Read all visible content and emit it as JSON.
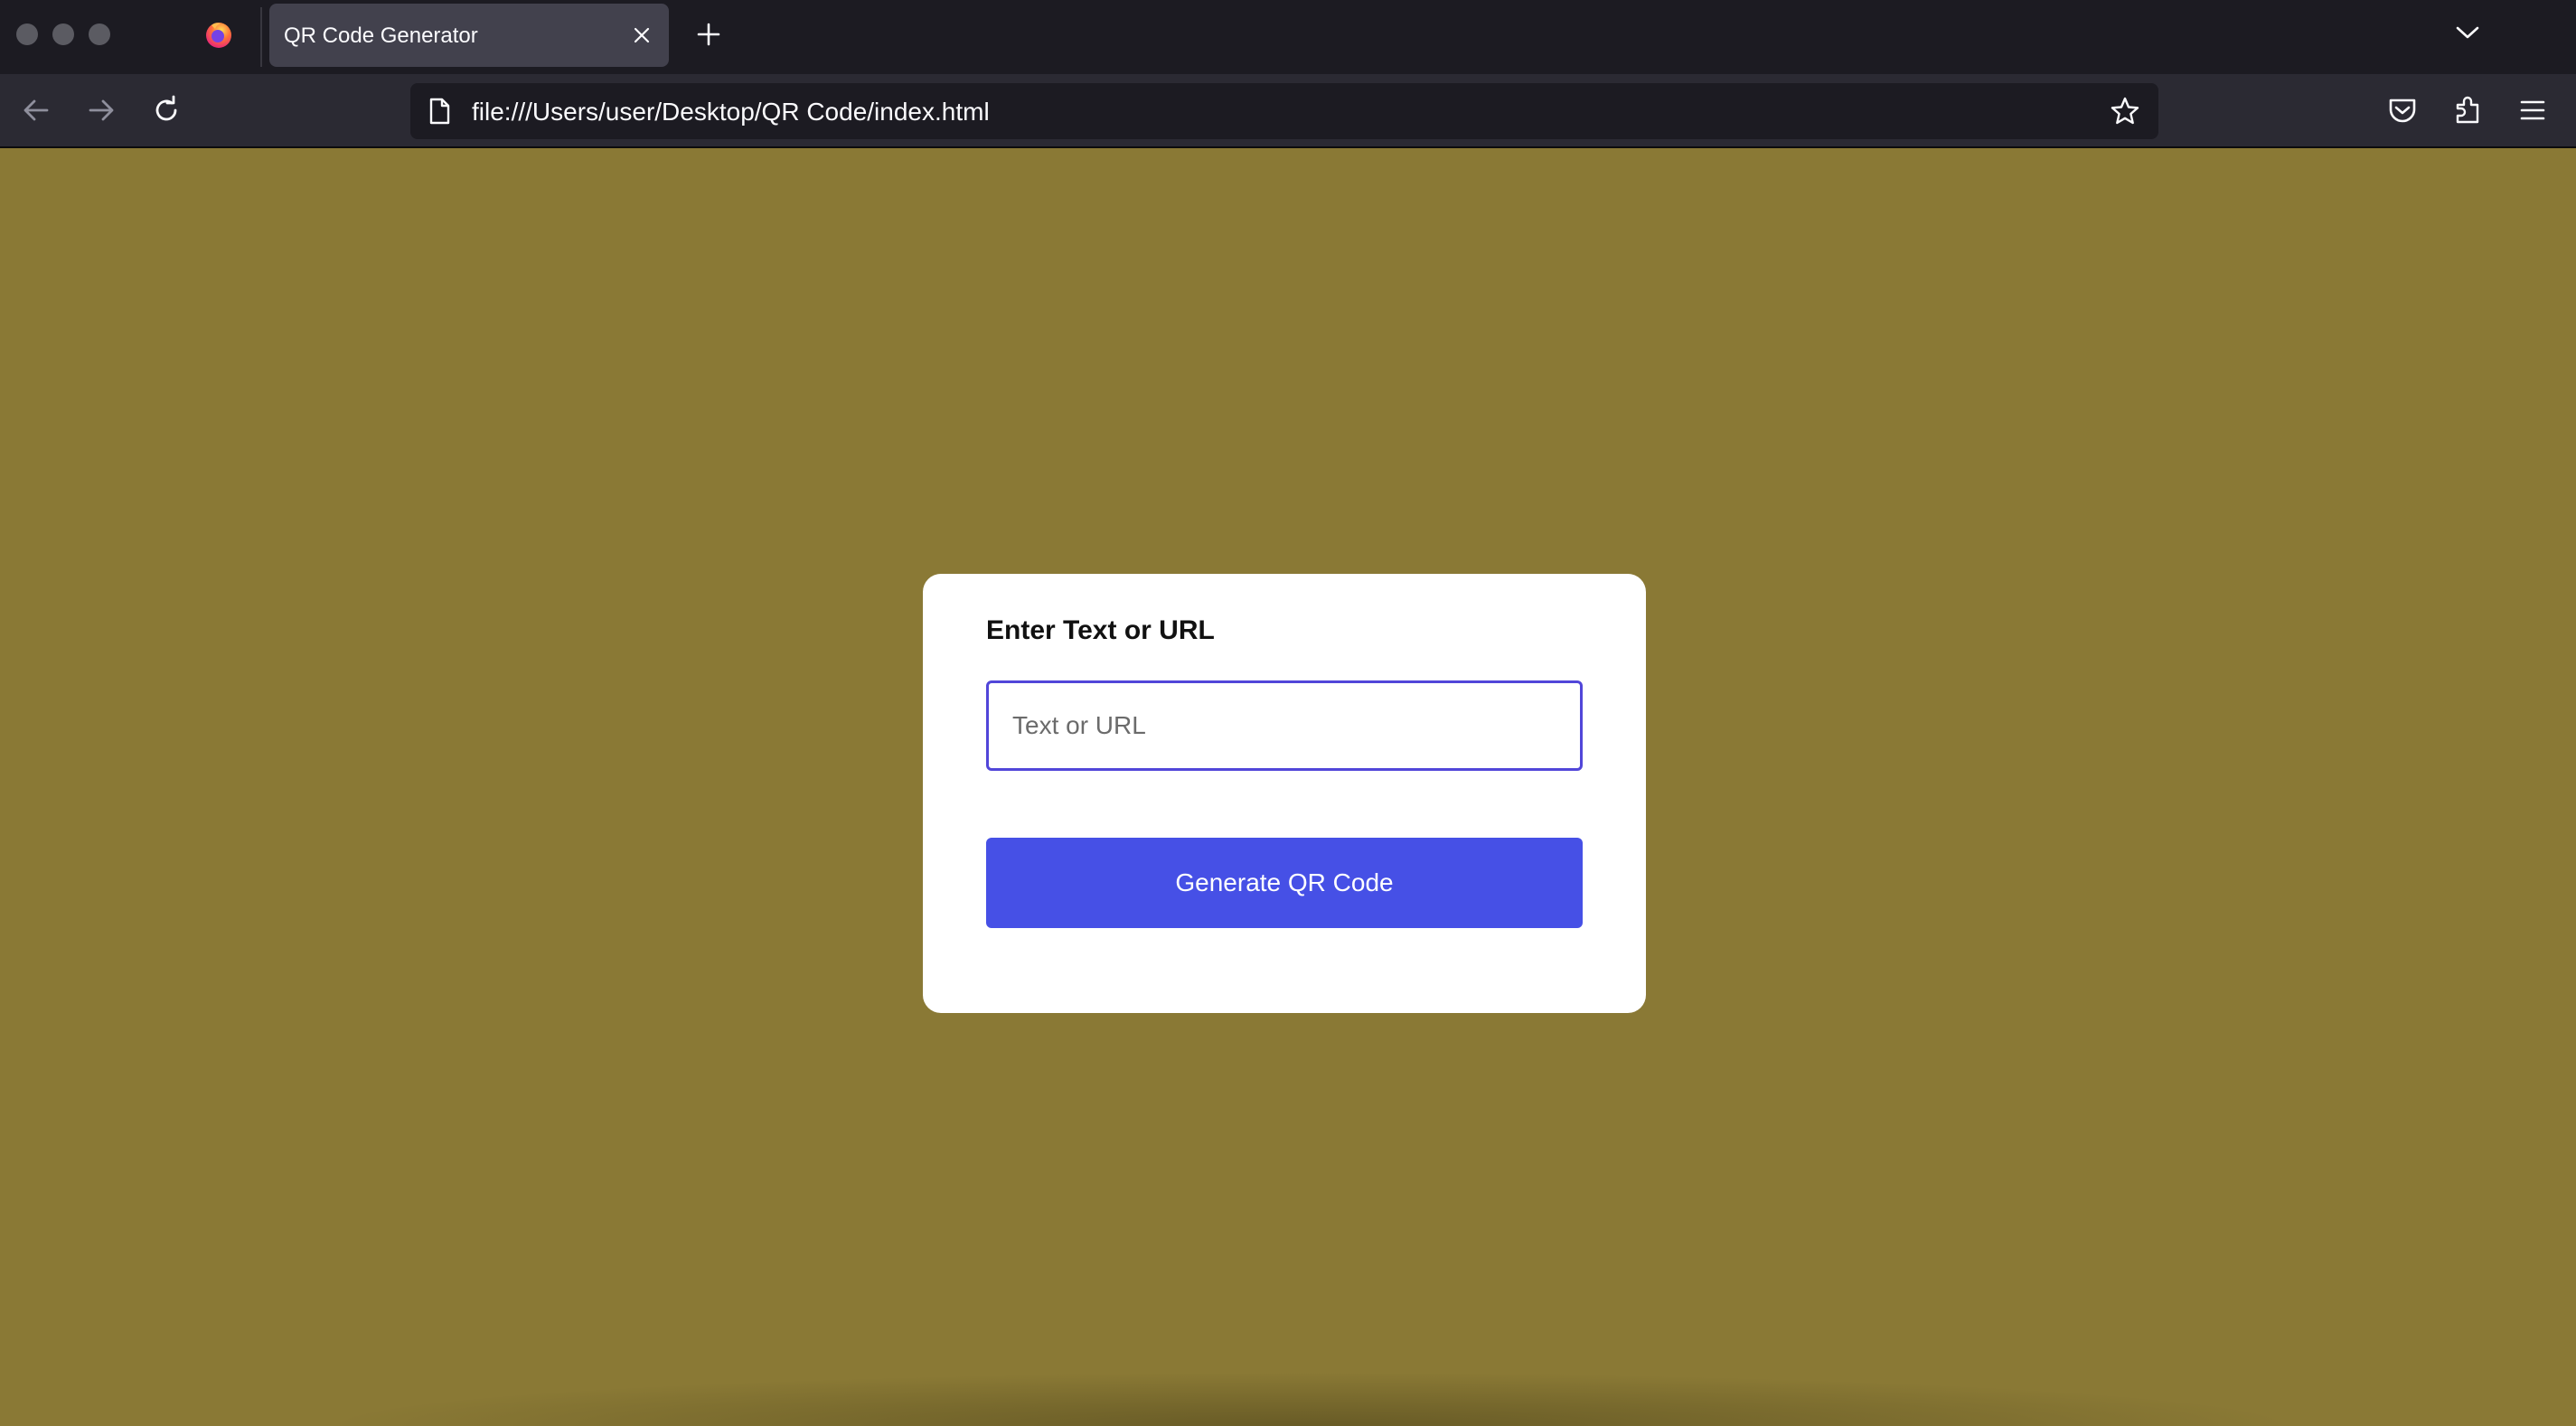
{
  "browser": {
    "tab_title": "QR Code Generator",
    "url": "file:///Users/user/Desktop/QR Code/index.html"
  },
  "page": {
    "background_color": "#8a7935",
    "form": {
      "heading": "Enter Text or URL",
      "input_placeholder": "Text or URL",
      "input_value": "",
      "button_label": "Generate QR Code",
      "button_color": "#4650e6",
      "input_border_color": "#5146d9"
    }
  },
  "icons": {
    "window_controls": [
      "close-dot-icon",
      "minimize-dot-icon",
      "maximize-dot-icon"
    ],
    "browser_logo": "firefox-icon",
    "tab_close": "close-icon",
    "new_tab": "plus-icon",
    "tab_list": "chevron-down-icon",
    "nav": [
      "back-arrow-icon",
      "forward-arrow-icon",
      "reload-icon"
    ],
    "url_page": "page-icon",
    "bookmark": "star-icon",
    "toolbar": [
      "pocket-icon",
      "extensions-icon",
      "hamburger-menu-icon"
    ]
  }
}
